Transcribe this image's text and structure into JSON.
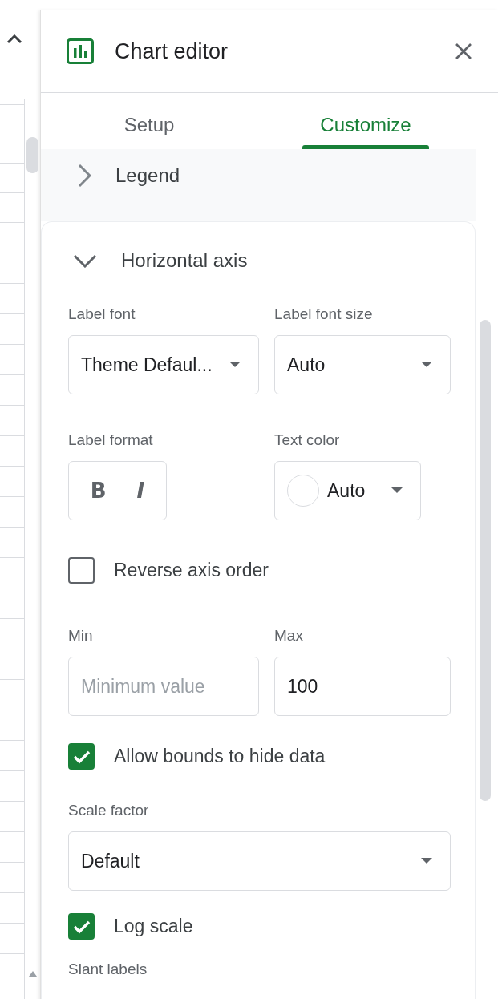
{
  "header": {
    "title": "Chart editor"
  },
  "tabs": [
    {
      "label": "Setup",
      "selected": false
    },
    {
      "label": "Customize",
      "selected": true
    }
  ],
  "legend": {
    "title": "Legend",
    "expanded": false
  },
  "horizontal_axis": {
    "title": "Horizontal axis",
    "expanded": true,
    "label_font": {
      "label": "Label font",
      "value": "Theme Defaul..."
    },
    "label_font_size": {
      "label": "Label font size",
      "value": "Auto"
    },
    "label_format": {
      "label": "Label format",
      "bold": "B",
      "italic": "I"
    },
    "text_color": {
      "label": "Text color",
      "value": "Auto"
    },
    "reverse_axis_order": {
      "label": "Reverse axis order",
      "checked": false
    },
    "min": {
      "label": "Min",
      "placeholder": "Minimum value"
    },
    "max": {
      "label": "Max",
      "value": "100"
    },
    "allow_bounds": {
      "label": "Allow bounds to hide data",
      "checked": true
    },
    "scale_factor": {
      "label": "Scale factor",
      "value": "Default"
    },
    "log_scale": {
      "label": "Log scale",
      "checked": true
    },
    "slant_labels": {
      "label": "Slant labels"
    }
  }
}
